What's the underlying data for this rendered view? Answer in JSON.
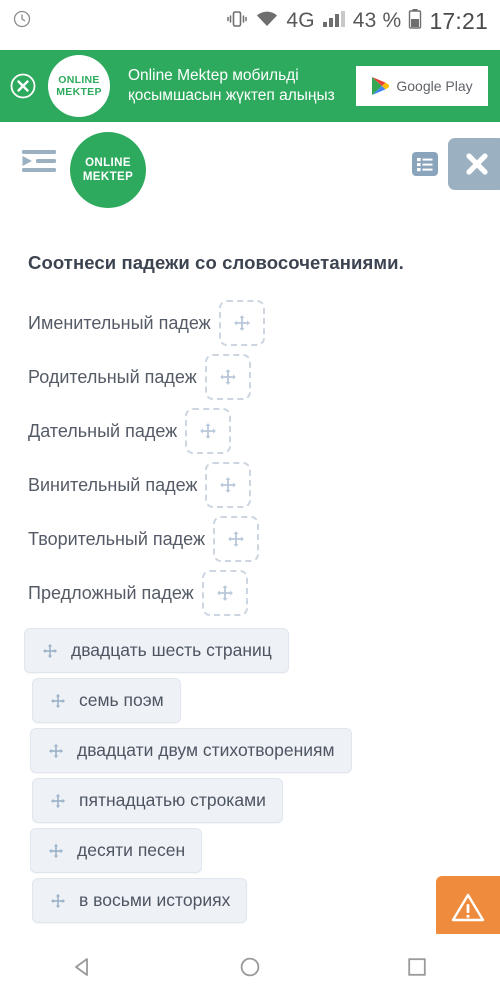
{
  "status_bar": {
    "alarm_icon": "clock-icon",
    "vibrate_icon": "vibrate-icon",
    "wifi_icon": "wifi-icon",
    "network": "4G",
    "signal_icon": "signal-bars-icon",
    "battery_percent": "43 %",
    "battery_icon": "battery-icon",
    "clock": "17:21"
  },
  "browser": {
    "url": "onlinemektep.org"
  },
  "banner": {
    "close_icon": "close-circle-icon",
    "logo_line1": "ONLINE",
    "logo_line2": "MEKTEP",
    "message": "Online Mektep мобильді қосымшасын жүктеп алыңыз",
    "store_button": "Google Play",
    "store_icon": "google-play-icon",
    "background_color": "#2eaa5e"
  },
  "toolbar": {
    "indent_icon": "indent-menu-icon",
    "logo_line1": "ONLINE",
    "logo_line2": "MEKTEP",
    "list_icon": "list-icon",
    "close_icon": "close-icon",
    "accent_color": "#2eaa5e",
    "close_bg_color": "#9bb0c0"
  },
  "task": {
    "title": "Соотнеси падежи со словосочетаниями.",
    "pairs": [
      {
        "label": "Именительный падеж",
        "dropzone_icon": "move-arrows-icon",
        "value": ""
      },
      {
        "label": "Родительный падеж",
        "dropzone_icon": "move-arrows-icon",
        "value": ""
      },
      {
        "label": "Дательный падеж",
        "dropzone_icon": "move-arrows-icon",
        "value": ""
      },
      {
        "label": "Винительный падеж",
        "dropzone_icon": "move-arrows-icon",
        "value": ""
      },
      {
        "label": "Творительный падеж",
        "dropzone_icon": "move-arrows-icon",
        "value": ""
      },
      {
        "label": "Предложный падеж",
        "dropzone_icon": "move-arrows-icon",
        "value": ""
      }
    ],
    "chips": [
      {
        "label": "двадцать шесть страниц",
        "drag_icon": "move-arrows-icon",
        "indent": 24
      },
      {
        "label": "семь поэм",
        "drag_icon": "move-arrows-icon",
        "indent": 32
      },
      {
        "label": "двадцати двум стихотворениям",
        "drag_icon": "move-arrows-icon",
        "indent": 30
      },
      {
        "label": "пятнадцатью строками",
        "drag_icon": "move-arrows-icon",
        "indent": 32
      },
      {
        "label": "десяти песен",
        "drag_icon": "move-arrows-icon",
        "indent": 30
      },
      {
        "label": "в восьми историях",
        "drag_icon": "move-arrows-icon",
        "indent": 32
      }
    ],
    "chip_bg_color": "#eef2f7"
  },
  "report_button": {
    "icon": "warning-triangle-icon",
    "color": "#ef8b3c"
  },
  "navigation_bar": {
    "back_icon": "back-triangle-icon",
    "home_icon": "home-circle-icon",
    "recents_icon": "recents-square-icon"
  }
}
